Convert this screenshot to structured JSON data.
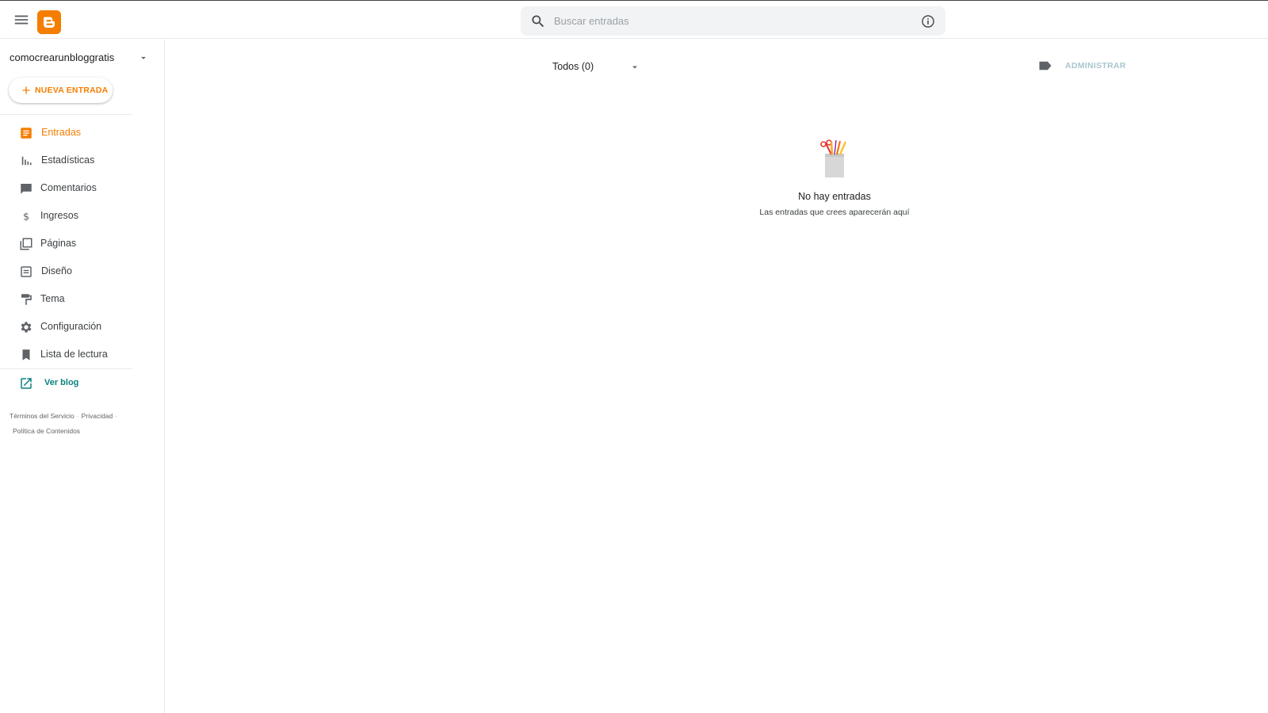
{
  "header": {
    "search": {
      "placeholder": "Buscar entradas",
      "value": ""
    },
    "icons": [
      "menu-icon",
      "blogger-logo",
      "search-icon",
      "info-icon"
    ]
  },
  "sidebar": {
    "blog_name": "comocrearunbloggratis",
    "new_post_label": "NUEVA ENTRADA",
    "items": [
      {
        "label": "Entradas",
        "icon": "posts-icon",
        "active": true
      },
      {
        "label": "Estadísticas",
        "icon": "stats-icon",
        "active": false
      },
      {
        "label": "Comentarios",
        "icon": "comments-icon",
        "active": false
      },
      {
        "label": "Ingresos",
        "icon": "earnings-icon",
        "active": false
      },
      {
        "label": "Páginas",
        "icon": "pages-icon",
        "active": false
      },
      {
        "label": "Diseño",
        "icon": "layout-icon",
        "active": false
      },
      {
        "label": "Tema",
        "icon": "theme-icon",
        "active": false
      },
      {
        "label": "Configuración",
        "icon": "settings-icon",
        "active": false
      },
      {
        "label": "Lista de lectura",
        "icon": "bookmark-icon",
        "active": false
      }
    ],
    "view_blog_label": "Ver blog",
    "footer": {
      "terms": "Términos del Servicio",
      "privacy": "Privacidad",
      "content_policy": "Política de Contenidos"
    }
  },
  "main": {
    "filter_label": "Todos (0)",
    "manage_label": "ADMINISTRAR",
    "empty_title": "No hay entradas",
    "empty_subtitle": "Las entradas que crees aparecerán aquí"
  },
  "colors": {
    "accent": "#f57d00",
    "link": "#0b8080",
    "manage_disabled": "#a8c7cc",
    "icon_gray": "#5f6368"
  }
}
